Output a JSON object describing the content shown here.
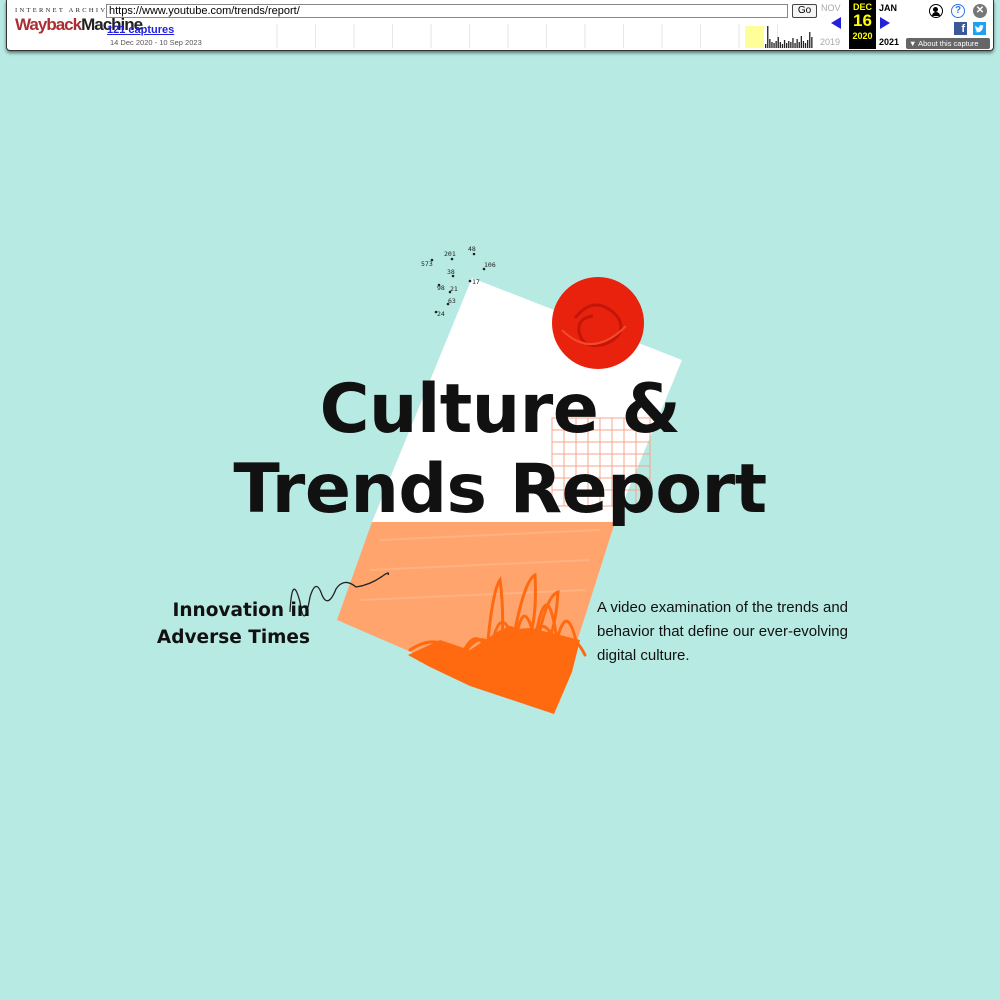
{
  "wayback": {
    "logo_top": "INTERNET ARCHIVE",
    "logo_wayback": "Wayback",
    "logo_machine": "Machine",
    "url": "https://www.youtube.com/trends/report/",
    "go_label": "Go",
    "captures_label": "121 captures",
    "date_range": "14 Dec 2020 - 10 Sep 2023",
    "prev_month": "NOV",
    "prev_year": "2019",
    "current_month": "DEC",
    "current_day": "16",
    "current_year": "2020",
    "next_month": "JAN",
    "next_year": "2021",
    "help_symbol": "?",
    "close_symbol": "✕",
    "facebook_letter": "f",
    "about_label": "▼ About this capture",
    "colors": {
      "current_bg": "#000000",
      "current_text": "#ffff00",
      "link": "#2222dd",
      "sparkline": "#222222",
      "highlight": "#ffff99"
    }
  },
  "hero": {
    "title_line1": "Culture &",
    "title_line2": "Trends Report",
    "subtitle_line1": "Innovation in",
    "subtitle_line2": "Adverse Times",
    "description": "A video examination of the trends and behavior that define our ever-evolving digital culture.",
    "scatter_labels": [
      "573",
      "201",
      "48",
      "106",
      "38",
      "17",
      "98",
      "21",
      "63",
      "24"
    ],
    "colors": {
      "background": "#b7eae3",
      "card": "#ffffff",
      "orange": "#ffa46c",
      "deep_orange": "#ff6a10",
      "sun": "#e8220c",
      "text": "#111111"
    }
  }
}
